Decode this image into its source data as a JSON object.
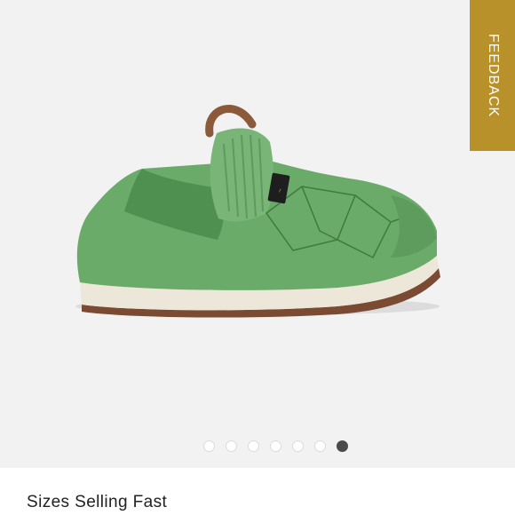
{
  "feedback": {
    "label": "FEEDBACK"
  },
  "colors": {
    "feedback_tab": "#b8912a",
    "gallery_bg": "#f2f2f2",
    "shoe_green": "#6bab6a",
    "active_dot": "#4a4a4a"
  },
  "gallery": {
    "image_subject": "green quilted slip-on shoe with brand tag",
    "brand_tag_icon": "teva-logo-tag-icon",
    "dots": [
      {
        "active": false
      },
      {
        "active": false
      },
      {
        "active": false
      },
      {
        "active": false
      },
      {
        "active": false
      },
      {
        "active": false
      },
      {
        "active": true
      }
    ]
  },
  "section": {
    "headline": "Sizes Selling Fast"
  }
}
